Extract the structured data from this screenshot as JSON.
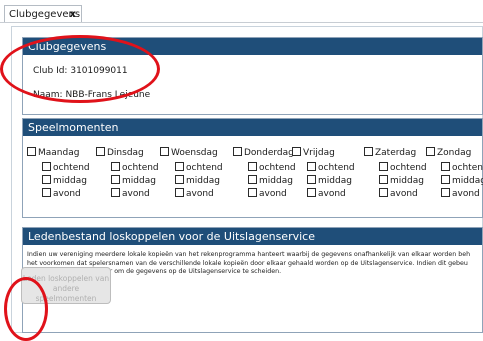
{
  "tab": {
    "label": "Clubgegevens",
    "close": "x"
  },
  "clubgegevens": {
    "title": "Clubgegevens",
    "club_id_label": "Club Id:",
    "club_id_value": "3101099011",
    "naam_label": "Naam:",
    "naam_value": "NBB-Frans Lejeune"
  },
  "speelmomenten": {
    "title": "Speelmomenten",
    "days": [
      "Maandag",
      "Dinsdag",
      "Woensdag",
      "Donderdag",
      "Vrijdag",
      "Zaterdag",
      "Zondag"
    ],
    "slots": [
      "ochtend",
      "middag",
      "avond"
    ]
  },
  "ledenbestand": {
    "title": "Ledenbestand loskoppelen voor de Uitslagenservice",
    "line1": "Indien uw vereniging meerdere lokale kopieën van het rekenprogramma hanteert waarbij de gegevens onafhankelijk van elkaar worden beh",
    "line2": "het voorkomen dat spelersnamen van de verschillende lokale kopieën door elkaar gehaald worden op de Uitslagenservice. Indien dit gebeu",
    "line3": "speelmomenten' hieronder om de gegevens op de Uitslagenservice te scheiden.",
    "button_line1": "Leden loskoppelen van",
    "button_line2": "andere speelmomenten"
  },
  "colors": {
    "header": "#1f4e79",
    "highlight": "#e0121a"
  }
}
